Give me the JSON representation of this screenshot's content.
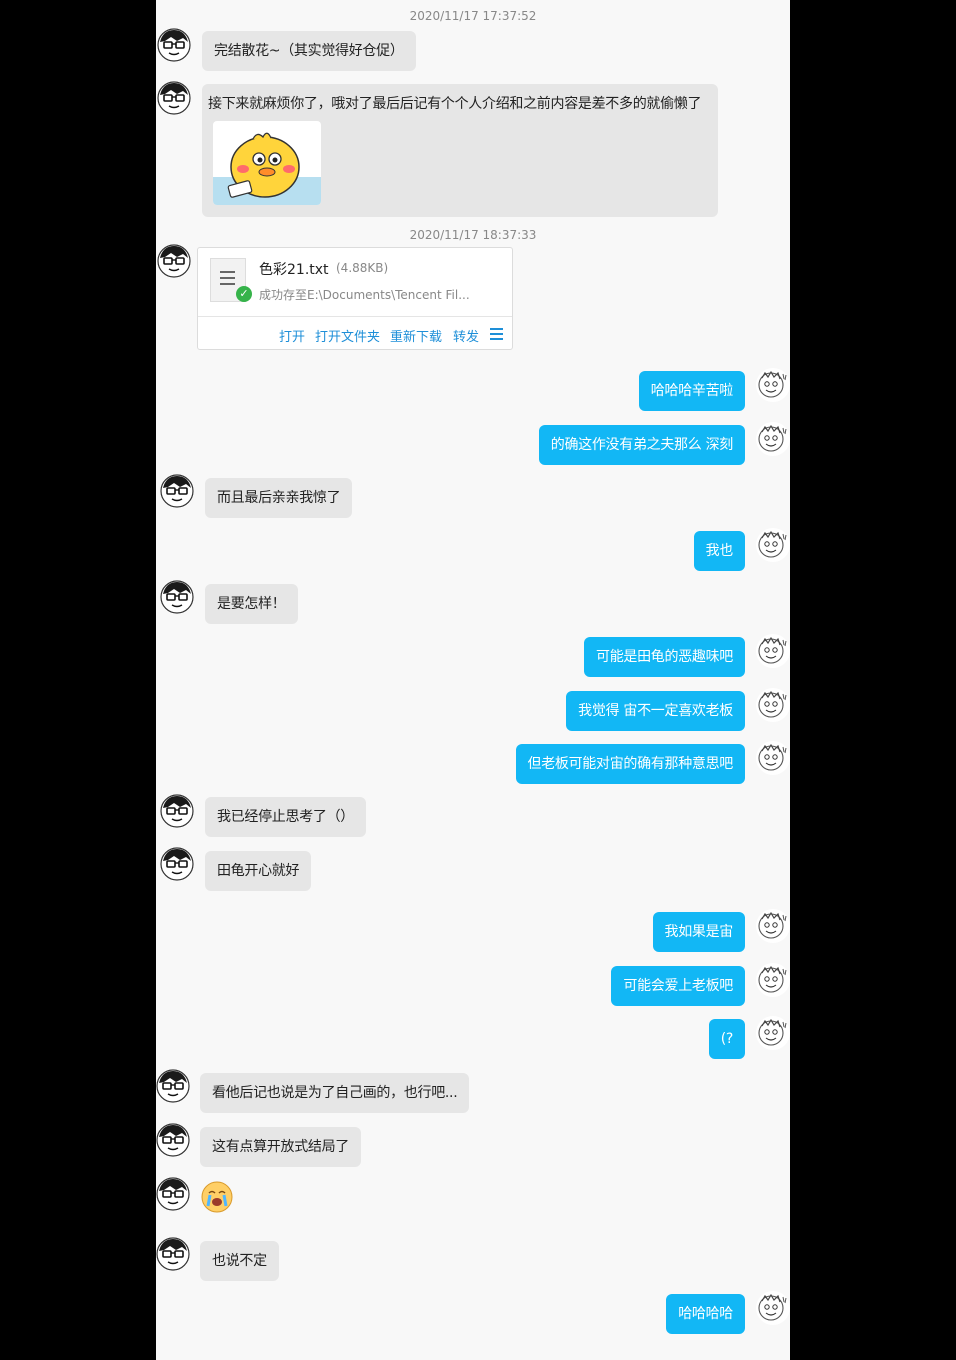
{
  "timestamps": [
    "2020/11/17 17:37:52",
    "2020/11/17 18:37:33"
  ],
  "messages": {
    "m1": "完结散花~（其实觉得好仓促）",
    "m2": "接下来就麻烦你了，哦对了最后后记有个个人介绍和之前内容是差不多的就偷懒了",
    "m3": "哈哈哈辛苦啦",
    "m4": "的确这作没有弟之夫那么 深刻",
    "m5": "而且最后亲亲我惊了",
    "m6": "我也",
    "m7": "是要怎样！",
    "m8": "可能是田龟的恶趣味吧",
    "m9": "我觉得 宙不一定喜欢老板",
    "m10": "但老板可能对宙的确有那种意思吧",
    "m11": "我已经停止思考了（）",
    "m12": "田龟开心就好",
    "m13": "我如果是宙",
    "m14": "可能会爱上老板吧",
    "m15": "(?",
    "m16": "看他后记也说是为了自己画的，也行吧...",
    "m17": "这有点算开放式结局了",
    "m18": "也说不定",
    "m19": "哈哈哈哈"
  },
  "file": {
    "name": "色彩21.txt",
    "size": "(4.88KB)",
    "status": "成功存至E:\\Documents\\Tencent Fil...",
    "actions": [
      "打开",
      "打开文件夹",
      "重新下载",
      "转发"
    ]
  },
  "icons": {
    "contact_avatar": "glasses-face-avatar",
    "self_avatar": "sketch-face-avatar",
    "sticker": "yellow-duck-sticker",
    "emoji": "crying-emoji",
    "file": "text-file-icon",
    "status": "check-icon",
    "menu": "menu-icon"
  },
  "colors": {
    "incoming_bubble": "#e6e6e6",
    "outgoing_bubble": "#12b7f5",
    "link": "#1e8fd8",
    "success": "#36b34a"
  }
}
